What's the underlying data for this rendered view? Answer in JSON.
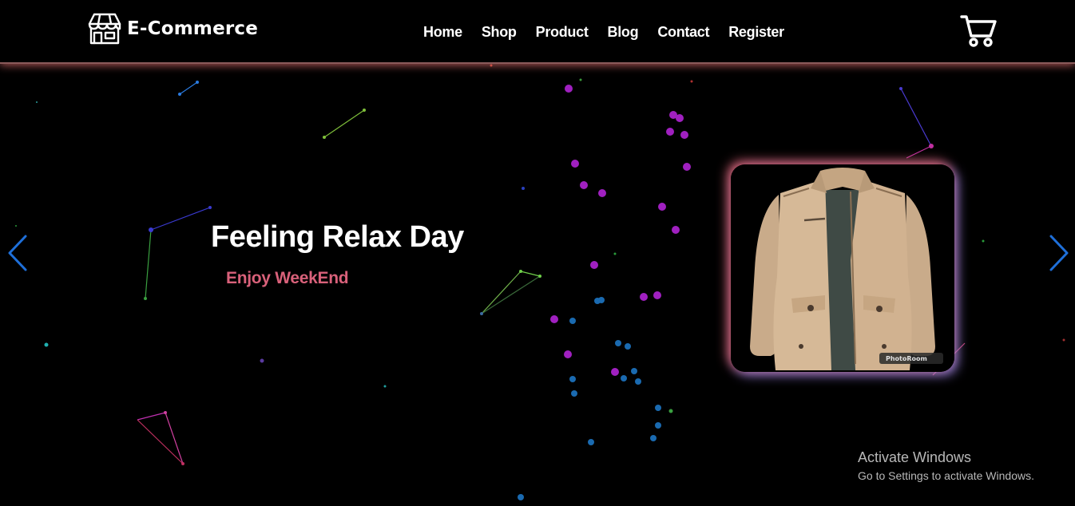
{
  "brand": {
    "name": "E-Commerce",
    "icon": "storefront-icon"
  },
  "nav": {
    "links": [
      "Home",
      "Shop",
      "Product",
      "Blog",
      "Contact",
      "Register"
    ]
  },
  "cart": {
    "icon": "shopping-cart-icon"
  },
  "hero": {
    "title": "Feeling Relax Day",
    "subtitle": "Enjoy WeekEnd",
    "image_badge": "PhotoRoom",
    "prev_icon": "chevron-left-icon",
    "next_icon": "chevron-right-icon"
  },
  "watermark": {
    "title": "Activate Windows",
    "subtitle": "Go to Settings to activate Windows."
  },
  "colors": {
    "background": "#000000",
    "accent_pink": "#d9617a",
    "arrow_blue": "#1e6fd9",
    "glow_pink": "#f06e82",
    "glow_lavender": "#a08cf0"
  }
}
